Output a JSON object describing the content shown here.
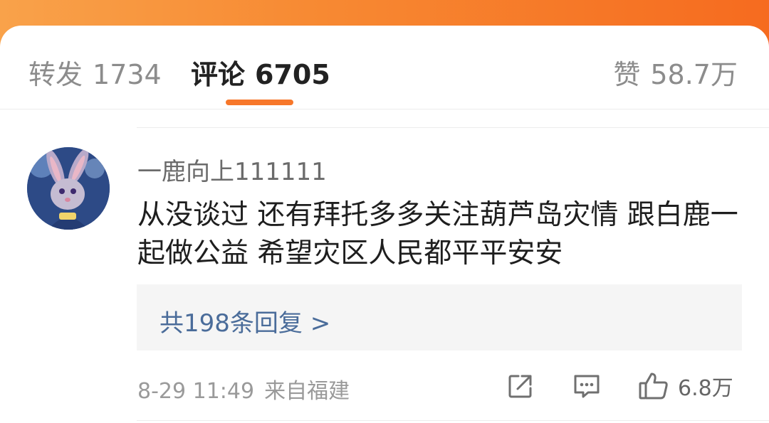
{
  "tabs": {
    "repost": {
      "label": "转发",
      "count": "1734"
    },
    "comments": {
      "label": "评论",
      "count": "6705"
    },
    "likes": {
      "label": "赞",
      "count": "58.7万"
    }
  },
  "comment": {
    "username": "一鹿向上111111",
    "text": "从没谈过  还有拜托多多关注葫芦岛灾情  跟白鹿一起做公益  希望灾区人民都平平安安",
    "replies_link": "共198条回复 >",
    "date": "8-29 11:49",
    "location": "来自福建",
    "like_count": "6.8万"
  },
  "colors": {
    "accent": "#f7772a",
    "link": "#4a6c9a"
  },
  "icons": [
    "share-icon",
    "comment-icon",
    "thumbs-up-icon"
  ]
}
